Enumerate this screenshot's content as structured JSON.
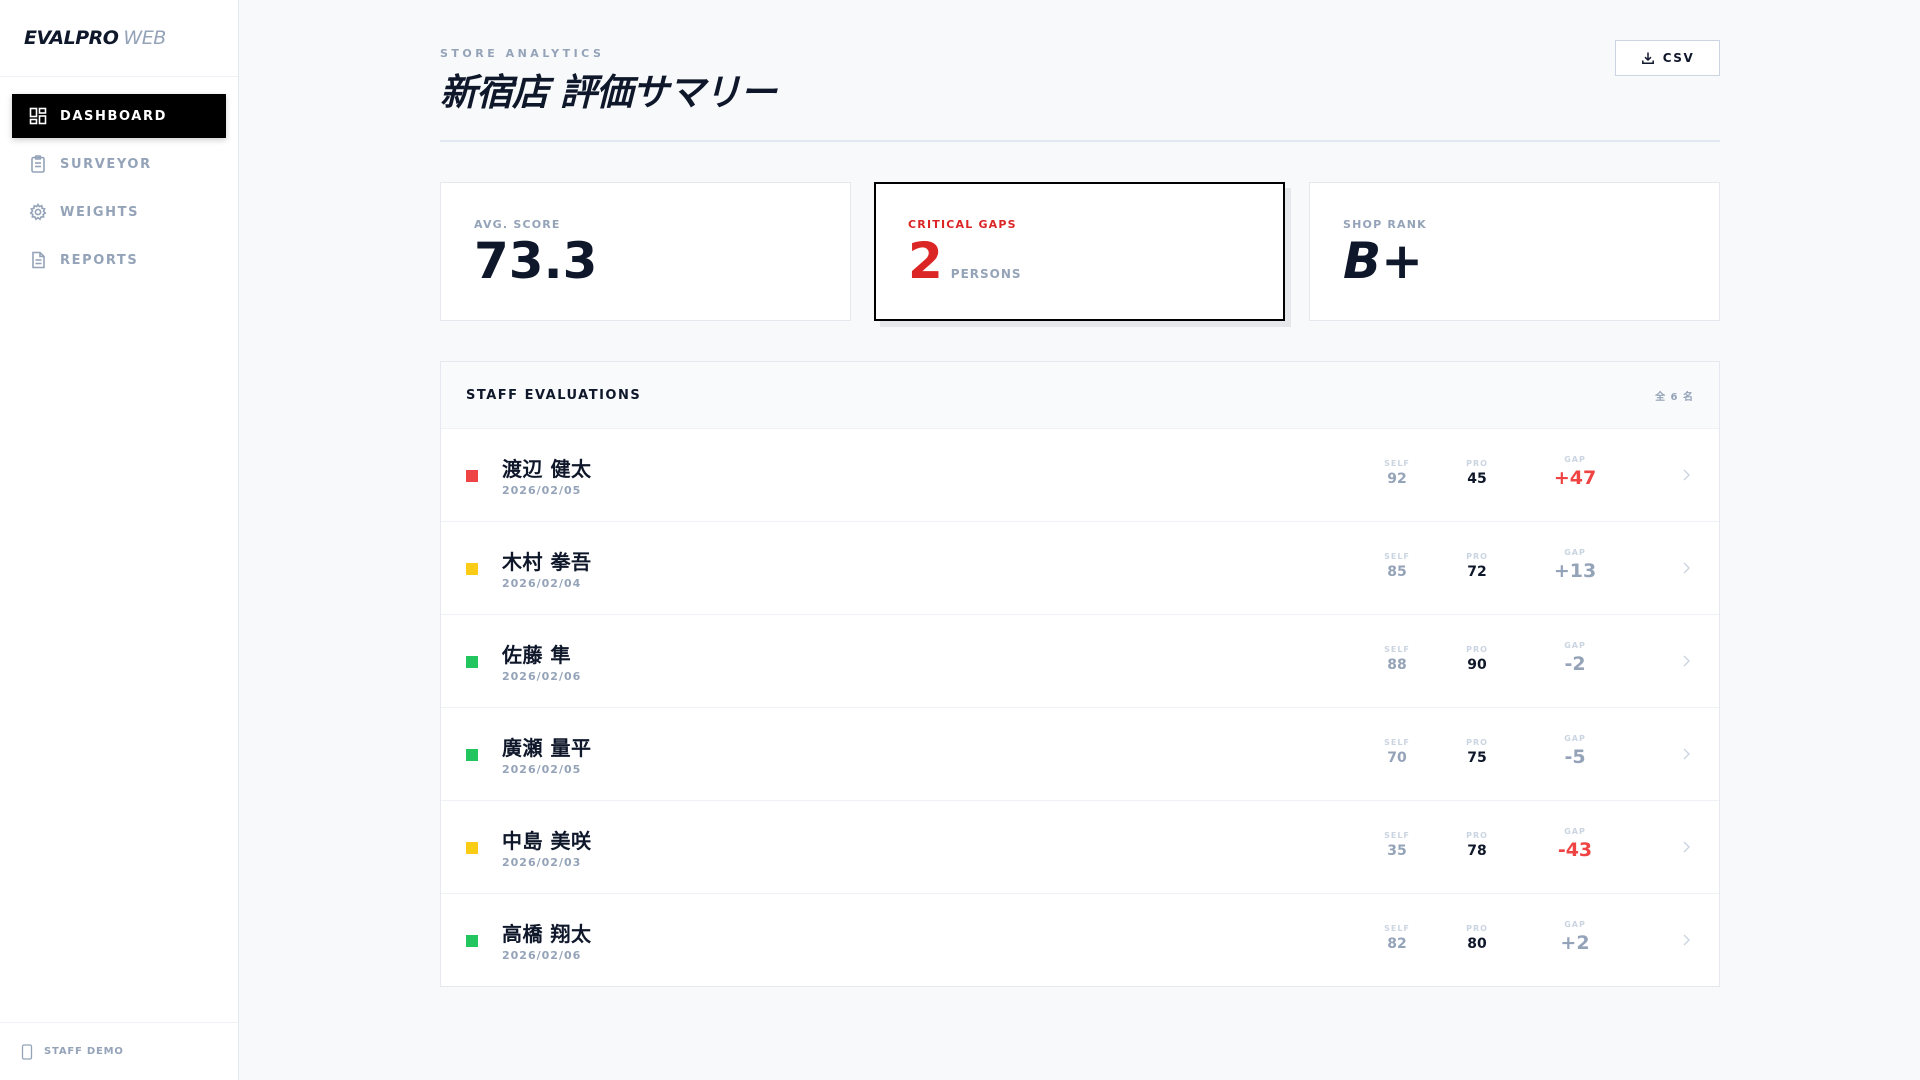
{
  "brand": {
    "name": "EVALPRO",
    "suffix": "WEB"
  },
  "nav": [
    {
      "label": "DASHBOARD",
      "icon": "dashboard-icon",
      "active": true
    },
    {
      "label": "SURVEYOR",
      "icon": "clipboard-icon",
      "active": false
    },
    {
      "label": "WEIGHTS",
      "icon": "gear-icon",
      "active": false
    },
    {
      "label": "REPORTS",
      "icon": "document-icon",
      "active": false
    }
  ],
  "footer": {
    "label": "STAFF DEMO",
    "icon": "phone-icon"
  },
  "header": {
    "kicker": "STORE ANALYTICS",
    "title": "新宿店 評価サマリー",
    "csv_label": "CSV",
    "csv_icon": "download-icon"
  },
  "kpis": {
    "avg": {
      "label": "AVG. SCORE",
      "value": "73.3"
    },
    "gaps": {
      "label": "CRITICAL GAPS",
      "value": "2",
      "unit": "PERSONS"
    },
    "rank": {
      "label": "SHOP RANK",
      "value": "B+"
    }
  },
  "staff": {
    "title": "STAFF EVALUATIONS",
    "count": "全 6 名",
    "col_self": "SELF",
    "col_pro": "PRO",
    "col_gap": "GAP",
    "rows": [
      {
        "name": "渡辺 健太",
        "date": "2026/02/05",
        "self": "92",
        "pro": "45",
        "gap": "+47",
        "status_color": "#ef4444",
        "critical": true
      },
      {
        "name": "木村 拳吾",
        "date": "2026/02/04",
        "self": "85",
        "pro": "72",
        "gap": "+13",
        "status_color": "#facc15",
        "critical": false
      },
      {
        "name": "佐藤 隼",
        "date": "2026/02/06",
        "self": "88",
        "pro": "90",
        "gap": "-2",
        "status_color": "#22c55e",
        "critical": false
      },
      {
        "name": "廣瀬 量平",
        "date": "2026/02/05",
        "self": "70",
        "pro": "75",
        "gap": "-5",
        "status_color": "#22c55e",
        "critical": false
      },
      {
        "name": "中島 美咲",
        "date": "2026/02/03",
        "self": "35",
        "pro": "78",
        "gap": "-43",
        "status_color": "#facc15",
        "critical": true
      },
      {
        "name": "高橋 翔太",
        "date": "2026/02/06",
        "self": "82",
        "pro": "80",
        "gap": "+2",
        "status_color": "#22c55e",
        "critical": false
      }
    ]
  },
  "colors": {
    "accent": "#000000",
    "critical": "#dc2626",
    "muted": "#94a3b8",
    "ok": "#22c55e",
    "warn": "#facc15"
  }
}
